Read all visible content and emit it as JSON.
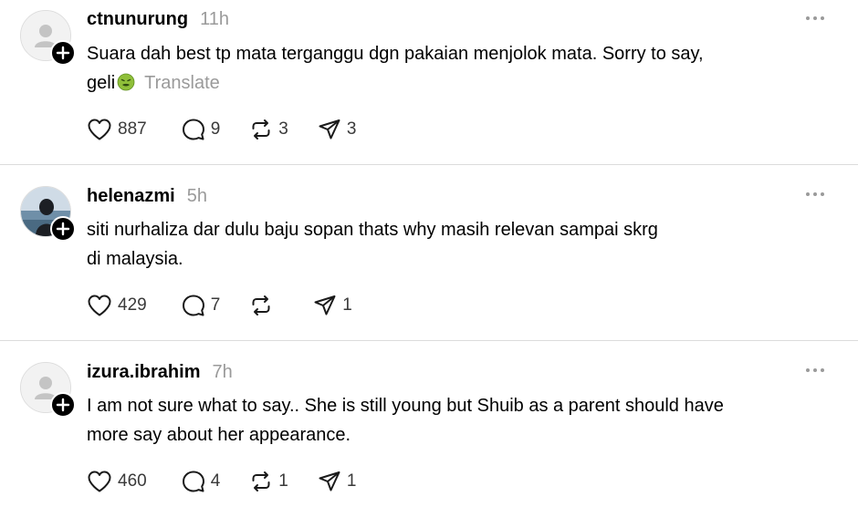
{
  "colors": {
    "text": "#000000",
    "muted": "#9a9a9a",
    "count": "#3a3a3a",
    "divider": "#dcdcdc",
    "badge": "#000000"
  },
  "posts": [
    {
      "username": "ctnunurung",
      "timestamp": "11h",
      "text_line1": "Suara dah best tp mata terganggu dgn pakaian menjolok mata. Sorry to say,",
      "text_line2": "geli",
      "emoji_icon": "nauseated-face-emoji-icon",
      "translate_label": "Translate",
      "likes": "887",
      "comments": "9",
      "reposts": "3",
      "shares": "3",
      "avatar": "default-avatar-icon"
    },
    {
      "username": "helenazmi",
      "timestamp": "5h",
      "text_line1": "siti nurhaliza dar dulu baju sopan thats why masih relevan sampai skrg",
      "text_line2": "di malaysia.",
      "likes": "429",
      "comments": "7",
      "reposts": "",
      "shares": "1",
      "avatar": "photo-avatar-icon"
    },
    {
      "username": "izura.ibrahim",
      "timestamp": "7h",
      "text_line1": "I am not sure what to say.. She is still young but Shuib as a parent should have",
      "text_line2": "more say about her appearance.",
      "likes": "460",
      "comments": "4",
      "reposts": "1",
      "shares": "1",
      "avatar": "default-avatar-icon"
    }
  ]
}
